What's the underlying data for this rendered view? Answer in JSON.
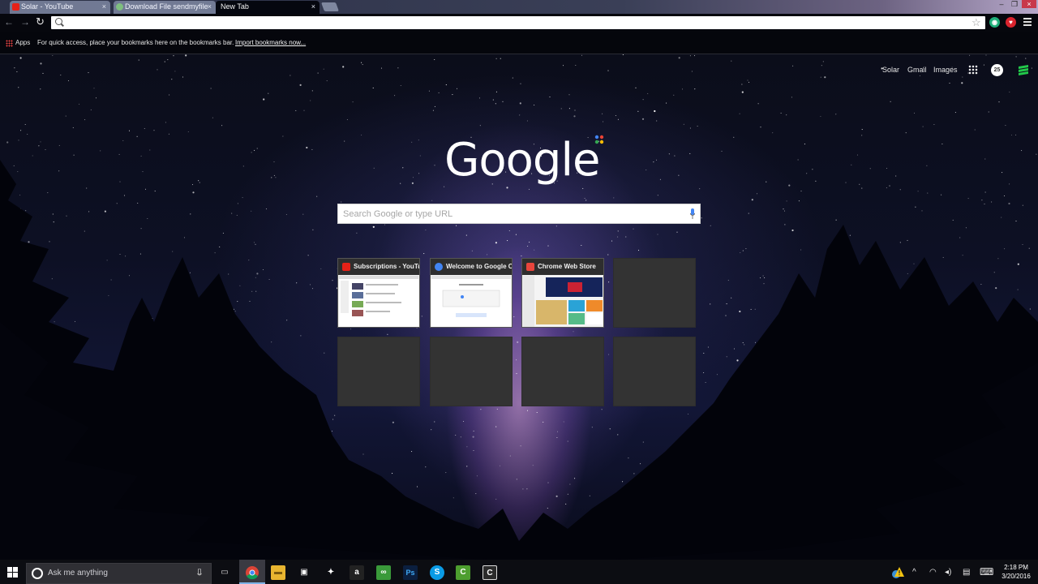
{
  "browser": {
    "tabs": [
      {
        "title": "Solar - YouTube",
        "favicon": "youtube-icon",
        "color": "#e62117"
      },
      {
        "title": "Download File sendmyfile",
        "favicon": "page-icon",
        "color": "#7fbf7f"
      },
      {
        "title": "New Tab",
        "favicon": "",
        "color": ""
      }
    ],
    "close_glyph": "×",
    "window_controls": {
      "minimize": "–",
      "maximize": "❐",
      "close": "×"
    },
    "nav": {
      "back": "←",
      "forward": "→",
      "reload": "↻"
    },
    "omnibox": {
      "value": ""
    },
    "star_glyph": "☆",
    "extensions": [
      {
        "name": "shield-extension-icon",
        "color": "#1fae7a",
        "glyph": "◉"
      },
      {
        "name": "heart-extension-icon",
        "color": "#d9232d",
        "glyph": "♥"
      }
    ]
  },
  "bookmarks_bar": {
    "apps_label": "Apps",
    "hint": "For quick access, place your bookmarks here on the bookmarks bar.",
    "import_link": "Import bookmarks now..."
  },
  "ntp": {
    "top_links": [
      "Solar",
      "Gmail",
      "Images"
    ],
    "notification_count": "25",
    "logo": "Google",
    "search_placeholder": "Search Google or type URL",
    "tiles": [
      {
        "title": "Subscriptions - YouTube",
        "favicon_color": "#e62117",
        "filled": true,
        "kind": "youtube"
      },
      {
        "title": "Welcome to Google Chrome",
        "favicon_color": "#4285f4",
        "filled": true,
        "kind": "chrome"
      },
      {
        "title": "Chrome Web Store",
        "favicon_color": "#e8453c",
        "filled": true,
        "kind": "store"
      },
      {
        "title": "",
        "filled": false
      },
      {
        "title": "",
        "filled": false
      },
      {
        "title": "",
        "filled": false
      },
      {
        "title": "",
        "filled": false
      },
      {
        "title": "",
        "filled": false
      }
    ]
  },
  "taskbar": {
    "search_placeholder": "Ask me anything",
    "apps": [
      {
        "name": "task-view-icon",
        "glyph": "▭",
        "color": "transparent"
      },
      {
        "name": "chrome-icon",
        "glyph": "●",
        "color": "transparent"
      },
      {
        "name": "file-explorer-icon",
        "glyph": "▬",
        "color": "#e8b530"
      },
      {
        "name": "store-icon",
        "glyph": "▣",
        "color": "transparent"
      },
      {
        "name": "dropbox-icon",
        "glyph": "✦",
        "color": "transparent"
      },
      {
        "name": "amazon-icon",
        "glyph": "a",
        "color": "#222"
      },
      {
        "name": "tripadvisor-icon",
        "glyph": "∞",
        "color": "#3a9a3a"
      },
      {
        "name": "photoshop-icon",
        "glyph": "Ps",
        "color": "#0b1f3f"
      },
      {
        "name": "skype-icon",
        "glyph": "S",
        "color": "#0a9be6"
      },
      {
        "name": "camtasia-icon",
        "glyph": "C",
        "color": "#4d9e2f"
      },
      {
        "name": "camtasia-recorder-icon",
        "glyph": "C",
        "color": "#2b2b2b"
      }
    ],
    "tray": {
      "chevron": "^",
      "wifi": "◠",
      "volume": "◂)",
      "message": "▤",
      "keyboard": "⌨"
    },
    "time": "2:18 PM",
    "date": "3/20/2016"
  }
}
